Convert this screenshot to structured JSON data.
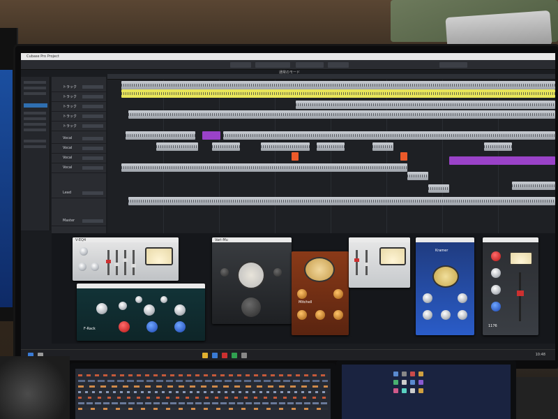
{
  "window": {
    "title": "Cubase Pro Project"
  },
  "toolbar": {
    "menu_label": "通常のモード"
  },
  "tracks": [
    {
      "name": "トラック"
    },
    {
      "name": "トラック"
    },
    {
      "name": "トラック"
    },
    {
      "name": "トラック"
    },
    {
      "name": "トラック"
    },
    {
      "name": "Vocal"
    },
    {
      "name": "Vocal"
    },
    {
      "name": "Vocal"
    },
    {
      "name": "Vocal"
    },
    {
      "name": "Lead"
    },
    {
      "name": "Master"
    }
  ],
  "plugins": [
    {
      "name": "V-EQ4"
    },
    {
      "name": "F-Rack"
    },
    {
      "name": "Vari-Mu"
    },
    {
      "name": "Mitchell"
    },
    {
      "name": "Kramer"
    },
    {
      "name": "1176"
    }
  ],
  "taskbar": {
    "time": "10:48"
  },
  "colors": {
    "accent": "#2f6fb1",
    "clip_yellow": "#e8e55a",
    "clip_purple": "#9a42c8",
    "clip_orange": "#ec5a2a"
  }
}
